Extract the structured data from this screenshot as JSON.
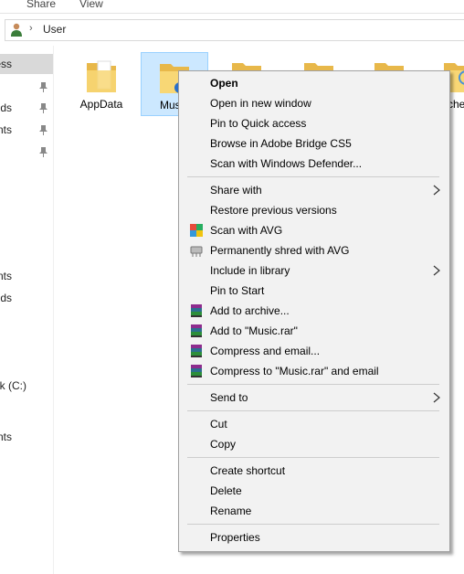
{
  "ribbon": {
    "tabs": [
      "Share",
      "View"
    ]
  },
  "address": {
    "crumb": "User"
  },
  "nav": {
    "items": [
      {
        "text": "ess",
        "selected": true
      },
      {
        "text": "ds"
      },
      {
        "text": "nts"
      },
      {
        "text": ""
      },
      {
        "text": "nts"
      },
      {
        "text": "ds"
      },
      {
        "text": "k (C:)"
      },
      {
        "text": "nts"
      }
    ]
  },
  "folders": [
    {
      "label": "AppData"
    },
    {
      "label": "Mus"
    },
    {
      "label": ""
    },
    {
      "label": ""
    },
    {
      "label": ""
    },
    {
      "label": "che"
    }
  ],
  "menu": {
    "items": [
      {
        "label": "Open"
      },
      {
        "label": "Open in new window"
      },
      {
        "label": "Pin to Quick access"
      },
      {
        "label": "Browse in Adobe Bridge CS5"
      },
      {
        "label": "Scan with Windows Defender..."
      },
      {
        "label": "Share with"
      },
      {
        "label": "Restore previous versions"
      },
      {
        "label": "Scan with AVG"
      },
      {
        "label": "Permanently shred with AVG"
      },
      {
        "label": "Include in library"
      },
      {
        "label": "Pin to Start"
      },
      {
        "label": "Add to archive..."
      },
      {
        "label": "Add to \"Music.rar\""
      },
      {
        "label": "Compress and email..."
      },
      {
        "label": "Compress to \"Music.rar\" and email"
      },
      {
        "label": "Send to"
      },
      {
        "label": "Cut"
      },
      {
        "label": "Copy"
      },
      {
        "label": "Create shortcut"
      },
      {
        "label": "Delete"
      },
      {
        "label": "Rename"
      },
      {
        "label": "Properties"
      }
    ]
  },
  "colors": {
    "selection": "#cce8ff",
    "menu_bg": "#f2f2f2",
    "folder": "#f8d775"
  }
}
